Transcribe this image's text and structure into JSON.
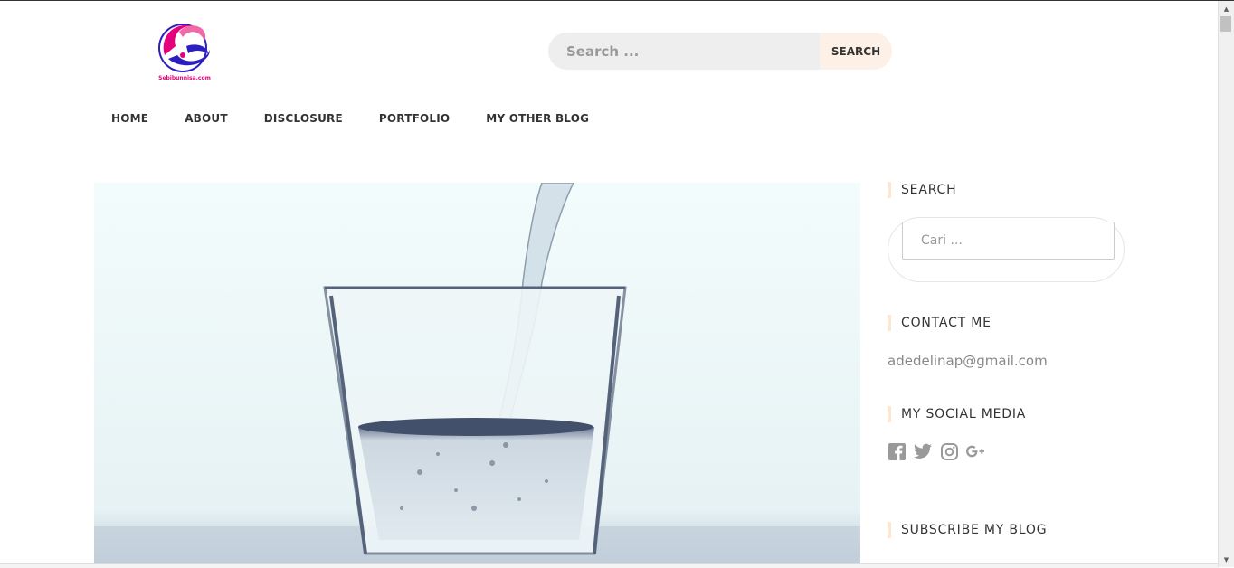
{
  "header": {
    "logo_text": "Sebibunnisa.com",
    "search": {
      "placeholder": "Search ...",
      "button_label": "SEARCH"
    }
  },
  "nav": {
    "items": [
      {
        "label": "HOME"
      },
      {
        "label": "ABOUT"
      },
      {
        "label": "DISCLOSURE"
      },
      {
        "label": "PORTFOLIO"
      },
      {
        "label": "MY OTHER BLOG"
      }
    ]
  },
  "sidebar": {
    "search": {
      "title": "SEARCH",
      "placeholder": "Cari ..."
    },
    "contact": {
      "title": "CONTACT ME",
      "email": "adedelinap@gmail.com"
    },
    "social": {
      "title": "MY SOCIAL MEDIA",
      "icons": [
        "facebook-icon",
        "twitter-icon",
        "instagram-icon",
        "google-plus-icon"
      ]
    },
    "subscribe": {
      "title": "SUBSCRIBE MY BLOG"
    }
  },
  "colors": {
    "accent": "#fde6d3",
    "logo_pink": "#e6007e",
    "logo_blue": "#2d1fbf",
    "search_bg": "#eeeeee"
  }
}
